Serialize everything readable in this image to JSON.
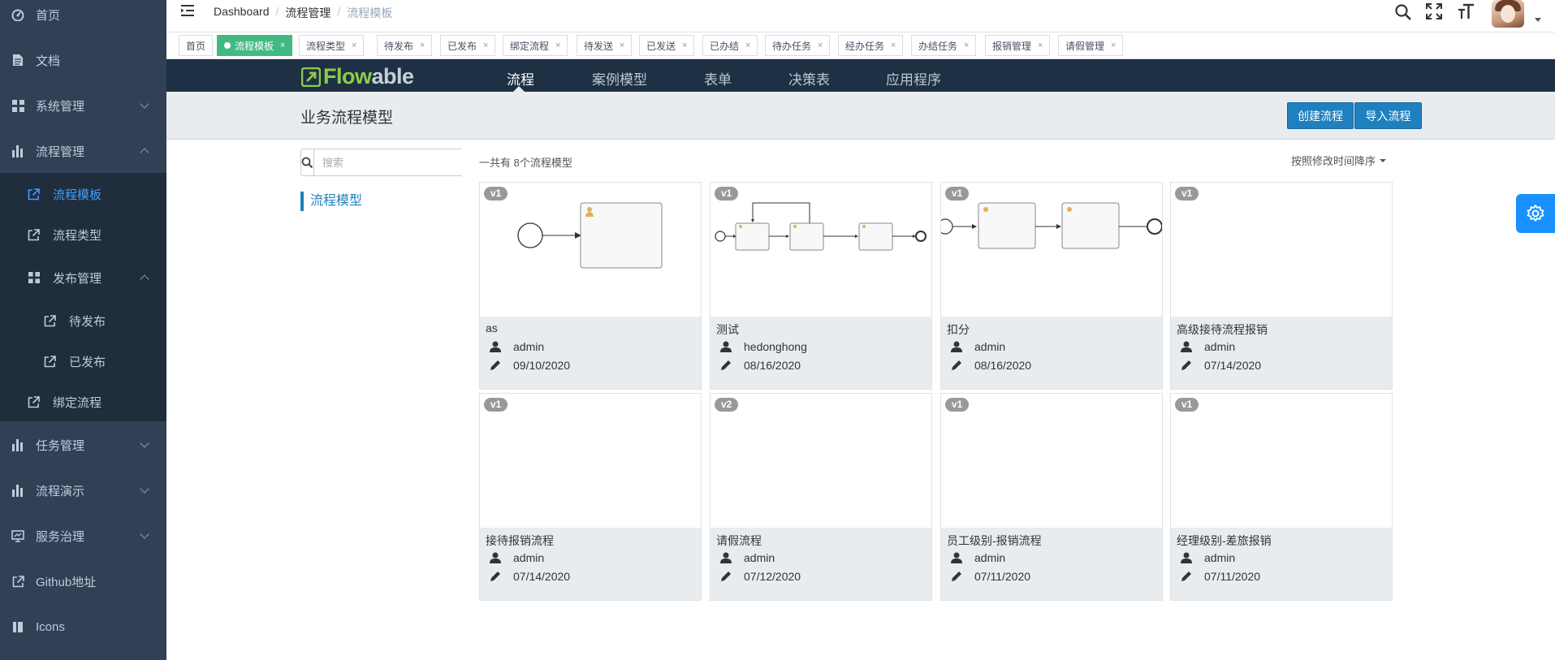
{
  "sidebar": {
    "items": [
      {
        "label": "首页",
        "icon": "dashboard-icon"
      },
      {
        "label": "文档",
        "icon": "document-icon"
      },
      {
        "label": "系统管理",
        "icon": "grid-icon"
      },
      {
        "label": "流程管理",
        "icon": "bar-chart-icon"
      },
      {
        "label": "任务管理",
        "icon": "bar-chart-icon"
      },
      {
        "label": "流程演示",
        "icon": "bar-chart-icon"
      },
      {
        "label": "服务治理",
        "icon": "monitor-icon"
      },
      {
        "label": "Github地址",
        "icon": "external-link-icon"
      },
      {
        "label": "Icons",
        "icon": "book-icon"
      }
    ],
    "sub": {
      "flow_template": "流程模板",
      "flow_type": "流程类型",
      "publish_mgmt": "发布管理",
      "pending_publish": "待发布",
      "published": "已发布",
      "bind_flow": "绑定流程"
    }
  },
  "breadcrumb": [
    "Dashboard",
    "流程管理",
    "流程模板"
  ],
  "breadcrumb_sep": "/",
  "tags": [
    {
      "label": "首页",
      "active": false,
      "closable": false
    },
    {
      "label": "流程模板",
      "active": true,
      "closable": true
    },
    {
      "label": "流程类型",
      "active": false,
      "closable": true
    },
    {
      "label": "待发布",
      "active": false,
      "closable": true
    },
    {
      "label": "已发布",
      "active": false,
      "closable": true
    },
    {
      "label": "绑定流程",
      "active": false,
      "closable": true
    },
    {
      "label": "待发送",
      "active": false,
      "closable": true
    },
    {
      "label": "已发送",
      "active": false,
      "closable": true
    },
    {
      "label": "已办结",
      "active": false,
      "closable": true
    },
    {
      "label": "待办任务",
      "active": false,
      "closable": true
    },
    {
      "label": "经办任务",
      "active": false,
      "closable": true
    },
    {
      "label": "办结任务",
      "active": false,
      "closable": true
    },
    {
      "label": "报销管理",
      "active": false,
      "closable": true
    },
    {
      "label": "请假管理",
      "active": false,
      "closable": true
    }
  ],
  "tag_close": "×",
  "flowable": {
    "logo_text_a": "Flow",
    "logo_text_b": "able",
    "nav": [
      "流程",
      "案例模型",
      "表单",
      "决策表",
      "应用程序"
    ]
  },
  "page": {
    "title": "业务流程模型",
    "create_button": "创建流程",
    "import_button": "导入流程",
    "search_placeholder": "搜索",
    "side_link": "流程模型",
    "count_text": "一共有 8个流程模型",
    "sort_text": "按照修改时间降序"
  },
  "models": [
    {
      "name": "as",
      "version": "v1",
      "user": "admin",
      "date": "09/10/2020",
      "diagram": "a"
    },
    {
      "name": "测试",
      "version": "v1",
      "user": "hedonghong",
      "date": "08/16/2020",
      "diagram": "b"
    },
    {
      "name": "扣分",
      "version": "v1",
      "user": "admin",
      "date": "08/16/2020",
      "diagram": "c"
    },
    {
      "name": "高级接待流程报销",
      "version": "v1",
      "user": "admin",
      "date": "07/14/2020",
      "diagram": "none"
    },
    {
      "name": "接待报销流程",
      "version": "v1",
      "user": "admin",
      "date": "07/14/2020",
      "diagram": "none"
    },
    {
      "name": "请假流程",
      "version": "v2",
      "user": "admin",
      "date": "07/12/2020",
      "diagram": "none"
    },
    {
      "name": "员工级别-报销流程",
      "version": "v1",
      "user": "admin",
      "date": "07/11/2020",
      "diagram": "none"
    },
    {
      "name": "经理级别-差旅报销",
      "version": "v1",
      "user": "admin",
      "date": "07/11/2020",
      "diagram": "none"
    }
  ],
  "colors": {
    "sidebar": "#304156",
    "submenu": "#1f2d3d",
    "active_link": "#409eff",
    "active_tag": "#42b983",
    "flowable_header": "#1e3044",
    "primary_button": "#1f80c0",
    "settings_fab": "#1890ff"
  }
}
